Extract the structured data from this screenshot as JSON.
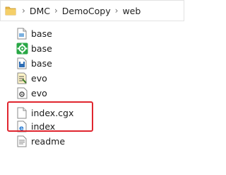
{
  "breadcrumb": {
    "items": [
      "DMC",
      "DemoCopy",
      "web"
    ],
    "separator": "›"
  },
  "files": [
    {
      "name": "base",
      "icon": "generic-file-icon"
    },
    {
      "name": "base",
      "icon": "gear-app-icon"
    },
    {
      "name": "base",
      "icon": "save-disk-icon"
    },
    {
      "name": "evo",
      "icon": "script-file-icon"
    },
    {
      "name": "evo",
      "icon": "settings-file-icon"
    },
    {
      "name": "index.cgx",
      "icon": "blank-file-icon"
    },
    {
      "name": "index",
      "icon": "edge-html-icon"
    },
    {
      "name": "readme",
      "icon": "text-file-icon"
    }
  ],
  "colors": {
    "highlight_border": "#e0262f",
    "folder": "#e8b84a",
    "gear": "#28a745",
    "edge": "#2b7cd3"
  }
}
